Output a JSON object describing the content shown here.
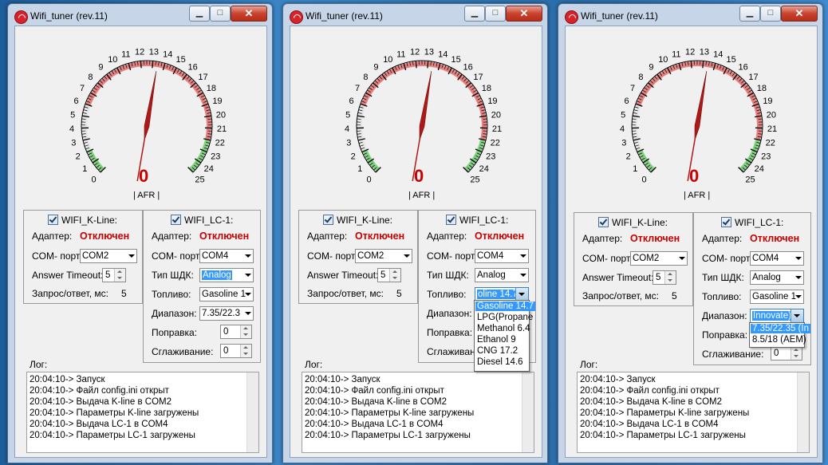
{
  "colors": {
    "status_red": "#c80000",
    "gauge_green": "#7fd07f",
    "gauge_red": "#e58080",
    "needle": "#b01818",
    "highlight": "#3399ff"
  },
  "windows": [
    {
      "title": "Wifi_tuner (rev.11)",
      "window_buttons": {
        "minimize": "▁",
        "maximize": "□",
        "close": "✕"
      },
      "gauge": {
        "value": "0",
        "unit": "| AFR |",
        "needle_value": 13.4,
        "ticks": [
          "0",
          "1",
          "2",
          "3",
          "4",
          "5",
          "6",
          "7",
          "8",
          "9",
          "10",
          "11",
          "12",
          "13",
          "14",
          "15",
          "16",
          "17",
          "18",
          "19",
          "20",
          "21",
          "22",
          "23",
          "24",
          "25"
        ]
      },
      "kline": {
        "checkbox_label": "WIFI_K-Line:",
        "checked": true,
        "adapter_label": "Адаптер:",
        "adapter_status": "Отключен",
        "com_label": "COM- порт:",
        "com_value": "COM2",
        "timeout_label": "Answer Timeout:",
        "timeout_value": "5",
        "req_label": "Запрос/ответ, мс:",
        "req_value": "5"
      },
      "lc1": {
        "checkbox_label": "WIFI_LC-1:",
        "checked": true,
        "adapter_label": "Адаптер:",
        "adapter_status": "Отключен",
        "com_label": "COM- порт:",
        "com_value": "COM4",
        "sensor_label": "Тип ШДК:",
        "sensor_value": "Analog",
        "fuel_label": "Топливо:",
        "fuel_value": "Gasoline 1",
        "range_label": "Диапазон:",
        "range_value": "7.35/22.3",
        "correction_label": "Поправка:",
        "correction_value": "0",
        "smoothing_label": "Сглаживание:",
        "smoothing_value": "0"
      },
      "log_label": "Лог:",
      "log_lines": [
        "20:04:10-> Запуск",
        "20:04:10-> Файл config.ini открыт",
        "20:04:10-> Выдача K-line в COM2",
        "20:04:10-> Параметры K-line загружены",
        "20:04:10-> Выдача LC-1 в COM4",
        "20:04:10-> Параметры LC-1 загружены"
      ]
    },
    {
      "title": "Wifi_tuner (rev.11)",
      "window_buttons": {
        "minimize": "▁",
        "maximize": "□",
        "close": "✕"
      },
      "gauge": {
        "value": "0",
        "unit": "| AFR |",
        "needle_value": 13.4,
        "ticks": [
          "0",
          "1",
          "2",
          "3",
          "4",
          "5",
          "6",
          "7",
          "8",
          "9",
          "10",
          "11",
          "12",
          "13",
          "14",
          "15",
          "16",
          "17",
          "18",
          "19",
          "20",
          "21",
          "22",
          "23",
          "24",
          "25"
        ]
      },
      "kline": {
        "checkbox_label": "WIFI_K-Line:",
        "checked": true,
        "adapter_label": "Адаптер:",
        "adapter_status": "Отключен",
        "com_label": "COM- порт:",
        "com_value": "COM2",
        "timeout_label": "Answer Timeout:",
        "timeout_value": "5",
        "req_label": "Запрос/ответ, мс:",
        "req_value": "5"
      },
      "lc1": {
        "checkbox_label": "WIFI_LC-1:",
        "checked": true,
        "adapter_label": "Адаптер:",
        "adapter_status": "Отключен",
        "com_label": "COM- порт:",
        "com_value": "COM4",
        "sensor_label": "Тип ШДК:",
        "sensor_value": "Analog",
        "fuel_label": "Топливо:",
        "fuel_value": "oline 14.7",
        "range_label": "Диапазон:",
        "correction_label": "Поправка:",
        "smoothing_label": "Сглаживание:"
      },
      "fuel_options": [
        "Gasoline 14.7",
        "LPG(Propane",
        "Methanol 6.4",
        "Ethanol 9",
        "CNG 17.2",
        "Diesel 14.6"
      ],
      "log_label": "Лог:",
      "log_lines": [
        "20:04:10-> Запуск",
        "20:04:10-> Файл config.ini открыт",
        "20:04:10-> Выдача K-line в COM2",
        "20:04:10-> Параметры K-line загружены",
        "20:04:10-> Выдача LC-1 в COM4",
        "20:04:10-> Параметры LC-1 загружены"
      ]
    },
    {
      "title": "Wifi_tuner (rev.11)",
      "window_buttons": {
        "minimize": "▁",
        "maximize": "□",
        "close": "✕"
      },
      "gauge": {
        "value": "0",
        "unit": "| AFR |",
        "needle_value": 13.4,
        "ticks": [
          "0",
          "1",
          "2",
          "3",
          "4",
          "5",
          "6",
          "7",
          "8",
          "9",
          "10",
          "11",
          "12",
          "13",
          "14",
          "15",
          "16",
          "17",
          "18",
          "19",
          "20",
          "21",
          "22",
          "23",
          "24",
          "25"
        ]
      },
      "kline": {
        "checkbox_label": "WIFI_K-Line:",
        "checked": true,
        "adapter_label": "Адаптер:",
        "adapter_status": "Отключен",
        "com_label": "COM- порт:",
        "com_value": "COM2",
        "timeout_label": "Answer Timeout:",
        "timeout_value": "5",
        "req_label": "Запрос/ответ, мс:",
        "req_value": "5"
      },
      "lc1": {
        "checkbox_label": "WIFI_LC-1:",
        "checked": true,
        "adapter_label": "Адаптер:",
        "adapter_status": "Отключен",
        "com_label": "COM- порт:",
        "com_value": "COM4",
        "sensor_label": "Тип ШДК:",
        "sensor_value": "Analog",
        "fuel_label": "Топливо:",
        "fuel_value": "Gasoline 1",
        "range_label": "Диапазон:",
        "range_value": "Innovate)",
        "correction_label": "Поправка:",
        "smoothing_label": "Сглаживание:",
        "smoothing_value": "0"
      },
      "range_options": [
        "7.35/22.35 (In",
        "8.5/18 (AEM)"
      ],
      "log_label": "Лог:",
      "log_lines": [
        "20:04:10-> Запуск",
        "20:04:10-> Файл config.ini открыт",
        "20:04:10-> Выдача K-line в COM2",
        "20:04:10-> Параметры K-line загружены",
        "20:04:10-> Выдача LC-1 в COM4",
        "20:04:10-> Параметры LC-1 загружены"
      ]
    }
  ]
}
